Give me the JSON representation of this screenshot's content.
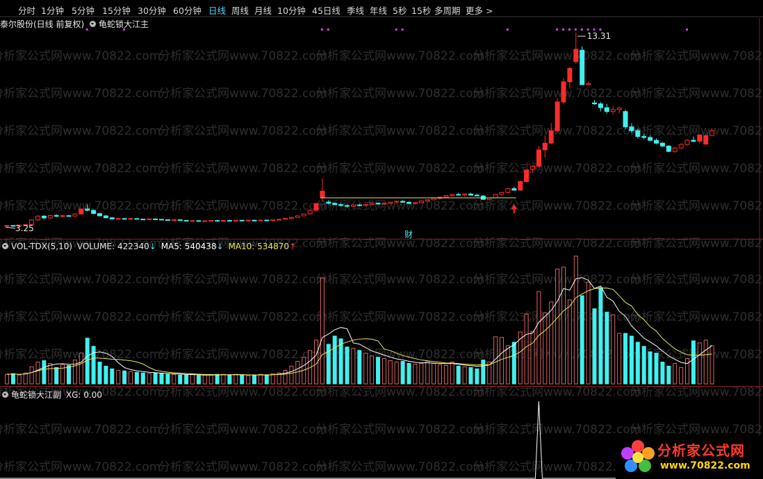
{
  "toolbar": {
    "items": [
      "分时",
      "1分钟",
      "5分钟",
      "15分钟",
      "30分钟",
      "60分钟",
      "日线",
      "周线",
      "月线",
      "10分钟",
      "45日线",
      "季线",
      "年线",
      "5秒",
      "15秒",
      "多周期",
      "更多 >"
    ],
    "active": "日线"
  },
  "main_panel": {
    "stock_label": "泰尔股份(日线 前复权)",
    "indicator_label": "龟蛇锁大江主",
    "high_label": "13.31",
    "low_label": "3.25",
    "marker_label": "财"
  },
  "volume_panel": {
    "label": "VOL-TDX(5,10)",
    "volume_label": "VOLUME:",
    "volume_value": "422340",
    "volume_arrow": "↓",
    "ma5_label": "MA5:",
    "ma5_value": "540438",
    "ma5_arrow": "↓",
    "ma10_label": "MA10:",
    "ma10_value": "534870",
    "ma10_arrow": "↑"
  },
  "sub_panel": {
    "label": "龟蛇锁大江副",
    "xg_label": "XG:",
    "xg_value": "0.00"
  },
  "watermark": {
    "text": "分析家公式网www.70822.com"
  },
  "logo": {
    "title": "分析家公式网",
    "url": "www.70822.com"
  },
  "colors": {
    "up": "#ff2a2a",
    "up_outline": "#e06262",
    "down": "#3ff0f0",
    "ma_white": "#ffffff",
    "ma_yellow": "#e8e85a",
    "active_tab": "#4fd6ff",
    "marker_dot": "#d040e0",
    "divider": "#8a1f1f"
  },
  "chart_data": {
    "type": "candlestick",
    "period": "daily",
    "price_annotations": {
      "high": 13.31,
      "low": 3.25
    },
    "candles": [
      [
        3.25,
        3.28,
        3.2,
        3.26
      ],
      [
        3.26,
        3.27,
        3.19,
        3.22
      ],
      [
        3.22,
        3.3,
        3.2,
        3.28
      ],
      [
        3.28,
        3.32,
        3.24,
        3.3
      ],
      [
        3.3,
        3.58,
        3.28,
        3.55
      ],
      [
        3.55,
        3.78,
        3.5,
        3.75
      ],
      [
        3.75,
        3.8,
        3.6,
        3.65
      ],
      [
        3.65,
        3.82,
        3.62,
        3.78
      ],
      [
        3.78,
        3.85,
        3.7,
        3.74
      ],
      [
        3.74,
        3.8,
        3.68,
        3.77
      ],
      [
        3.77,
        3.82,
        3.72,
        3.75
      ],
      [
        3.75,
        3.9,
        3.73,
        3.86
      ],
      [
        3.86,
        4.15,
        3.84,
        4.12
      ],
      [
        4.12,
        4.35,
        4.0,
        4.05
      ],
      [
        4.05,
        4.1,
        3.86,
        3.88
      ],
      [
        3.88,
        3.92,
        3.74,
        3.76
      ],
      [
        3.76,
        3.8,
        3.64,
        3.66
      ],
      [
        3.66,
        3.7,
        3.58,
        3.6
      ],
      [
        3.6,
        3.66,
        3.56,
        3.62
      ],
      [
        3.62,
        3.65,
        3.58,
        3.6
      ],
      [
        3.6,
        3.64,
        3.56,
        3.62
      ],
      [
        3.62,
        3.64,
        3.57,
        3.59
      ],
      [
        3.59,
        3.61,
        3.55,
        3.58
      ],
      [
        3.58,
        3.62,
        3.55,
        3.6
      ],
      [
        3.6,
        3.63,
        3.56,
        3.58
      ],
      [
        3.58,
        3.6,
        3.54,
        3.56
      ],
      [
        3.56,
        3.58,
        3.52,
        3.54
      ],
      [
        3.54,
        3.58,
        3.51,
        3.56
      ],
      [
        3.56,
        3.58,
        3.51,
        3.52
      ],
      [
        3.52,
        3.54,
        3.47,
        3.49
      ],
      [
        3.49,
        3.53,
        3.46,
        3.51
      ],
      [
        3.51,
        3.53,
        3.47,
        3.48
      ],
      [
        3.48,
        3.52,
        3.45,
        3.5
      ],
      [
        3.5,
        3.54,
        3.47,
        3.52
      ],
      [
        3.52,
        3.55,
        3.48,
        3.5
      ],
      [
        3.5,
        3.54,
        3.47,
        3.52
      ],
      [
        3.52,
        3.56,
        3.49,
        3.51
      ],
      [
        3.51,
        3.55,
        3.48,
        3.53
      ],
      [
        3.53,
        3.56,
        3.5,
        3.51
      ],
      [
        3.51,
        3.55,
        3.48,
        3.53
      ],
      [
        3.53,
        3.57,
        3.5,
        3.52
      ],
      [
        3.52,
        3.56,
        3.49,
        3.54
      ],
      [
        3.54,
        3.57,
        3.5,
        3.52
      ],
      [
        3.52,
        3.56,
        3.49,
        3.55
      ],
      [
        3.55,
        3.6,
        3.52,
        3.58
      ],
      [
        3.58,
        3.65,
        3.56,
        3.63
      ],
      [
        3.63,
        3.7,
        3.6,
        3.68
      ],
      [
        3.68,
        3.78,
        3.66,
        3.76
      ],
      [
        3.76,
        3.88,
        3.74,
        3.86
      ],
      [
        3.86,
        4.1,
        3.84,
        4.05
      ],
      [
        4.05,
        4.45,
        4.0,
        4.4
      ],
      [
        4.72,
        5.7,
        4.5,
        5.05
      ],
      [
        4.48,
        4.58,
        4.35,
        4.42
      ],
      [
        4.42,
        4.46,
        4.3,
        4.35
      ],
      [
        4.35,
        4.42,
        4.24,
        4.3
      ],
      [
        4.3,
        4.36,
        4.2,
        4.26
      ],
      [
        4.26,
        4.36,
        4.22,
        4.33
      ],
      [
        4.33,
        4.4,
        4.26,
        4.3
      ],
      [
        4.3,
        4.38,
        4.26,
        4.35
      ],
      [
        4.35,
        4.44,
        4.3,
        4.42
      ],
      [
        4.42,
        4.46,
        4.35,
        4.38
      ],
      [
        4.38,
        4.45,
        4.33,
        4.42
      ],
      [
        4.42,
        4.5,
        4.38,
        4.48
      ],
      [
        4.48,
        4.56,
        4.42,
        4.52
      ],
      [
        4.52,
        4.58,
        4.44,
        4.47
      ],
      [
        4.47,
        4.52,
        4.38,
        4.41
      ],
      [
        4.41,
        4.48,
        4.36,
        4.45
      ],
      [
        4.45,
        4.56,
        4.42,
        4.54
      ],
      [
        4.54,
        4.62,
        4.5,
        4.6
      ],
      [
        4.6,
        4.7,
        4.56,
        4.68
      ],
      [
        4.68,
        4.76,
        4.62,
        4.74
      ],
      [
        4.74,
        4.84,
        4.7,
        4.82
      ],
      [
        4.82,
        4.9,
        4.76,
        4.88
      ],
      [
        4.88,
        4.96,
        4.82,
        4.85
      ],
      [
        4.85,
        4.92,
        4.78,
        4.9
      ],
      [
        4.9,
        4.96,
        4.82,
        4.84
      ],
      [
        4.84,
        4.92,
        4.78,
        4.8
      ],
      [
        4.8,
        4.84,
        4.6,
        4.62
      ],
      [
        4.62,
        4.72,
        4.55,
        4.7
      ],
      [
        4.7,
        4.9,
        4.66,
        4.88
      ],
      [
        4.88,
        5.02,
        4.85,
        4.98
      ],
      [
        4.98,
        5.2,
        4.95,
        5.18
      ],
      [
        5.18,
        5.28,
        5.08,
        5.1
      ],
      [
        5.1,
        5.6,
        5.08,
        5.55
      ],
      [
        5.55,
        6.2,
        5.5,
        6.15
      ],
      [
        6.2,
        6.4,
        6.0,
        6.35
      ],
      [
        6.35,
        7.4,
        6.3,
        7.2
      ],
      [
        7.2,
        7.95,
        6.8,
        7.55
      ],
      [
        7.55,
        8.6,
        7.5,
        8.2
      ],
      [
        8.2,
        9.9,
        8.1,
        9.7
      ],
      [
        9.7,
        10.95,
        9.6,
        10.75
      ],
      [
        10.75,
        11.55,
        10.4,
        11.45
      ],
      [
        11.8,
        13.31,
        11.7,
        12.45
      ],
      [
        12.4,
        12.6,
        10.6,
        10.6
      ],
      [
        10.6,
        10.75,
        10.55,
        10.65
      ],
      [
        9.65,
        9.8,
        9.55,
        9.6
      ],
      [
        9.6,
        9.7,
        9.2,
        9.4
      ],
      [
        9.4,
        9.6,
        9.1,
        9.2
      ],
      [
        9.2,
        9.48,
        9.05,
        9.3
      ],
      [
        9.3,
        9.45,
        9.1,
        9.38
      ],
      [
        9.2,
        9.3,
        8.3,
        8.4
      ],
      [
        8.4,
        8.6,
        8.1,
        8.2
      ],
      [
        8.2,
        8.3,
        7.8,
        7.9
      ],
      [
        7.9,
        8.05,
        7.75,
        7.85
      ],
      [
        7.85,
        7.95,
        7.65,
        7.7
      ],
      [
        7.7,
        7.8,
        7.5,
        7.55
      ],
      [
        7.55,
        7.62,
        7.35,
        7.4
      ],
      [
        7.4,
        7.45,
        7.08,
        7.12
      ],
      [
        7.12,
        7.35,
        7.05,
        7.3
      ],
      [
        7.3,
        7.55,
        7.25,
        7.48
      ],
      [
        7.48,
        7.75,
        7.4,
        7.7
      ],
      [
        7.7,
        7.9,
        7.6,
        7.65
      ],
      [
        7.65,
        8.0,
        7.55,
        7.98
      ],
      [
        7.5,
        8.05,
        7.48,
        7.95
      ],
      [
        7.95,
        8.3,
        7.9,
        8.2
      ]
    ],
    "volume": [
      14,
      15,
      13,
      16,
      25,
      32,
      34,
      30,
      24,
      28,
      27,
      35,
      45,
      67,
      55,
      32,
      26,
      22,
      20,
      19,
      18,
      17,
      16,
      15,
      16,
      15,
      14,
      14,
      13,
      13,
      14,
      12,
      13,
      13,
      14,
      14,
      13,
      14,
      13,
      12,
      13,
      14,
      13,
      15,
      16,
      20,
      26,
      33,
      39,
      49,
      64,
      155,
      58,
      70,
      66,
      54,
      52,
      49,
      45,
      41,
      39,
      37,
      34,
      32,
      33,
      30,
      29,
      30,
      33,
      30,
      28,
      27,
      32,
      26,
      25,
      24,
      22,
      35,
      32,
      69,
      68,
      56,
      61,
      76,
      102,
      77,
      135,
      104,
      120,
      168,
      171,
      123,
      187,
      129,
      149,
      110,
      141,
      105,
      101,
      74,
      74,
      70,
      61,
      55,
      47,
      45,
      32,
      26,
      30,
      24,
      37,
      63,
      60,
      64,
      56
    ],
    "indicator_xg": {
      "value": 0.0,
      "signal_at_index": 86,
      "signal_value": 1
    },
    "signal_dot_indices": [
      13,
      19,
      51,
      52,
      63,
      64,
      81,
      89,
      90,
      91,
      92,
      93,
      94,
      95,
      96,
      110
    ],
    "yellow_line": {
      "from_index": 51,
      "to_index": 82,
      "value": 4.7
    }
  }
}
